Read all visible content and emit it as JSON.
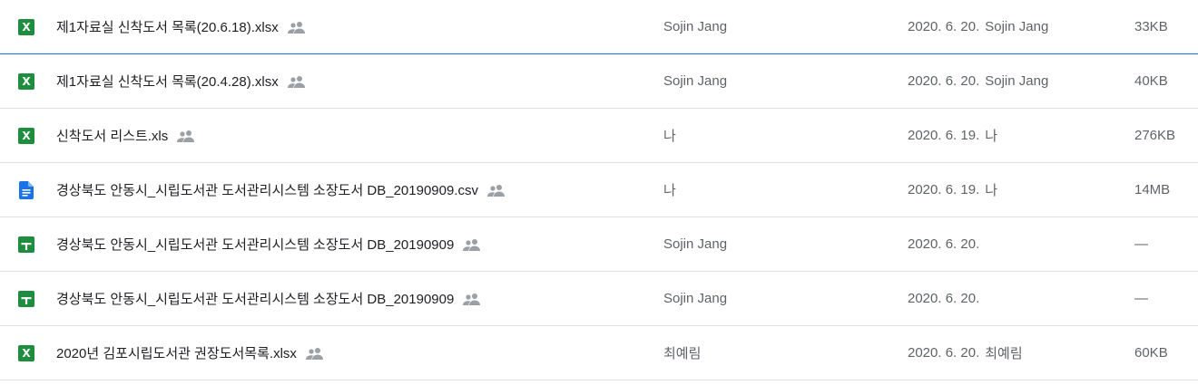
{
  "colors": {
    "excel": "#1e8e3e",
    "sheets": "#1e8e3e",
    "docs": "#1a73e8",
    "selected_border": "#1a73e8"
  },
  "files": [
    {
      "name": "제1자료실 신착도서 목록(20.6.18).xlsx",
      "icon": "excel-icon",
      "icon_letter": "X",
      "shared_icon": "people-icon",
      "owner": "Sojin Jang",
      "modified_date": "2020. 6. 20.",
      "modified_by": "Sojin Jang",
      "size": "33KB"
    },
    {
      "name": "제1자료실 신착도서 목록(20.4.28).xlsx",
      "icon": "excel-icon",
      "icon_letter": "X",
      "shared_icon": "people-icon",
      "owner": "Sojin Jang",
      "modified_date": "2020. 6. 20.",
      "modified_by": "Sojin Jang",
      "size": "40KB"
    },
    {
      "name": "신착도서 리스트.xls",
      "icon": "excel-icon",
      "icon_letter": "X",
      "shared_icon": "people-icon",
      "owner": "나",
      "modified_date": "2020. 6. 19.",
      "modified_by": "나",
      "size": "276KB"
    },
    {
      "name": "경상북도 안동시_시립도서관 도서관리시스템 소장도서 DB_20190909.csv",
      "icon": "docs-icon",
      "shared_icon": "people-icon",
      "owner": "나",
      "modified_date": "2020. 6. 19.",
      "modified_by": "나",
      "size": "14MB"
    },
    {
      "name": "경상북도 안동시_시립도서관 도서관리시스템 소장도서 DB_20190909",
      "icon": "sheets-icon",
      "shared_icon": "people-icon",
      "owner": "Sojin Jang",
      "modified_date": "2020. 6. 20.",
      "modified_by": "",
      "size": "—"
    },
    {
      "name": "경상북도 안동시_시립도서관 도서관리시스템 소장도서 DB_20190909",
      "icon": "sheets-icon",
      "shared_icon": "people-icon",
      "owner": "Sojin Jang",
      "modified_date": "2020. 6. 20.",
      "modified_by": "",
      "size": "—"
    },
    {
      "name": "2020년 김포시립도서관 권장도서목록.xlsx",
      "icon": "excel-icon",
      "icon_letter": "X",
      "shared_icon": "people-icon",
      "owner": "최예림",
      "modified_date": "2020. 6. 20.",
      "modified_by": "최예림",
      "size": "60KB"
    }
  ]
}
